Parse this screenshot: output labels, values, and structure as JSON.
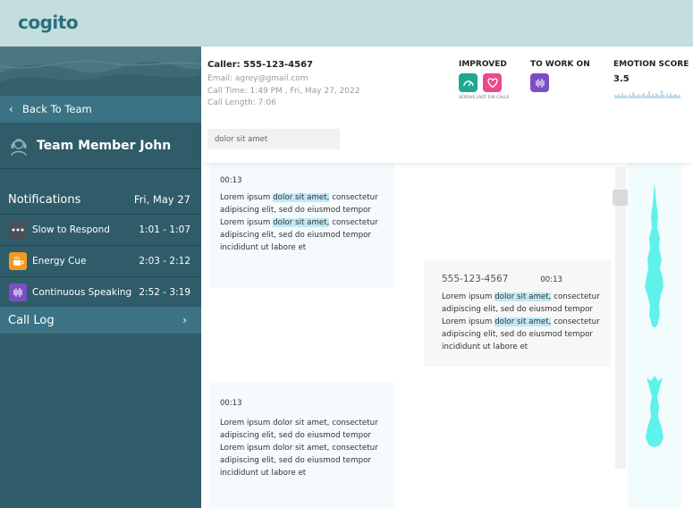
{
  "app": {
    "logo": "cogito"
  },
  "sidebar": {
    "back_label": "Back To Team",
    "member_name": "Team Member John",
    "notifications_title": "Notifications",
    "notifications_date": "Fri, May 27",
    "notifications": [
      {
        "label": "Slow to Respond",
        "time": "1:01 - 1:07",
        "icon": "ellipsis-icon",
        "color": "#4a4f59"
      },
      {
        "label": "Energy Cue",
        "time": "2:03 - 2:12",
        "icon": "coffee-icon",
        "color": "#f39a1e"
      },
      {
        "label": "Continuous Speaking",
        "time": "2:52 - 3:19",
        "icon": "sound-waves-icon",
        "color": "#7b4fc4"
      }
    ],
    "call_log_label": "Call Log"
  },
  "header": {
    "caller": "Caller: 555-123-4567",
    "email": "Email: agrey@gmail.com",
    "call_time": "Call Time: 1:49 PM , Fri, May 27, 2022",
    "call_length": "Call Length: 7:06",
    "search_placeholder": "dolor sit amet",
    "improved_label": "IMPROVED",
    "versus_label": "VERSUS LAST 100 CALLS",
    "to_work_on_label": "TO WORK ON",
    "emotion_score_label": "EMOTION SCORE",
    "emotion_score_value": "3.5"
  },
  "transcript": {
    "messages": [
      {
        "time": "00:13",
        "lines": [
          [
            "Lorem ipsum ",
            "dolor sit amet,",
            " consectetur"
          ],
          [
            "adipiscing elit, sed do eiusmod tempor"
          ],
          [
            "Lorem ipsum ",
            "dolor sit amet,",
            " consectetur"
          ],
          [
            "adipiscing elit, sed do eiusmod tempor"
          ],
          [
            "incididunt ut labore et"
          ]
        ]
      },
      {
        "number": "555-123-4567",
        "time": "00:13",
        "lines": [
          [
            "Lorem ipsum ",
            "dolor sit amet,",
            " consectetur"
          ],
          [
            "adipiscing elit, sed do eiusmod tempor"
          ],
          [
            "Lorem ipsum ",
            "dolor sit amet,",
            " consectetur"
          ],
          [
            "adipiscing elit, sed do eiusmod tempor"
          ],
          [
            "incididunt ut labore et"
          ]
        ]
      },
      {
        "time": "00:13",
        "lines": [
          [
            "Lorem ipsum dolor sit amet, consectetur"
          ],
          [
            "adipiscing elit, sed do eiusmod tempor"
          ],
          [
            "Lorem ipsum dolor sit amet, consectetur"
          ],
          [
            "adipiscing elit, sed do eiusmod tempor"
          ],
          [
            "incididunt ut labore et"
          ]
        ]
      }
    ]
  },
  "colors": {
    "accent_teal": "#2f5c68",
    "highlight": "#bfe9f4",
    "waveform": "#5ff2ec"
  }
}
